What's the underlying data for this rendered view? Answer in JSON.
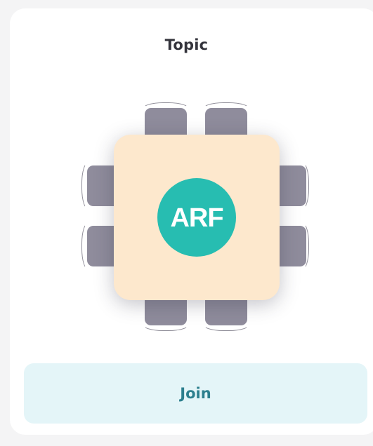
{
  "room": {
    "title": "Topic",
    "logo_text": "ARF",
    "join_label": "Join",
    "seats": 8
  },
  "colors": {
    "table": "#fde8cd",
    "logo": "#27bdb1",
    "chair": "#8f8c9c",
    "join_bg": "#e4f5f8",
    "join_text": "#2c7f8e"
  }
}
